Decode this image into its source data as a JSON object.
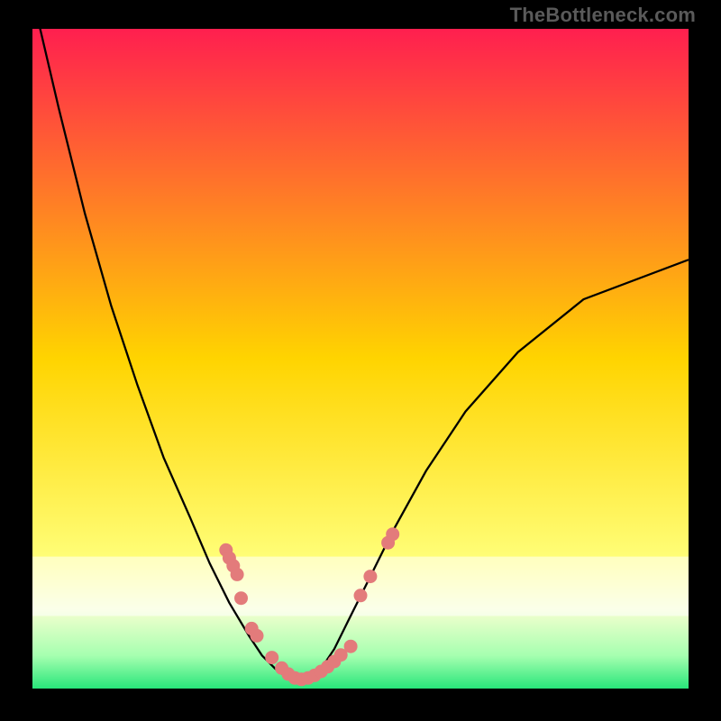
{
  "attribution": "TheBottleneck.com",
  "chart_data": {
    "type": "line",
    "title": "",
    "xlabel": "",
    "ylabel": "",
    "xlim": [
      0,
      100
    ],
    "ylim": [
      0,
      100
    ],
    "grid": false,
    "legend": false,
    "background_gradient_stops": [
      {
        "offset": 0,
        "color": "#ff1f4f"
      },
      {
        "offset": 50,
        "color": "#ffd400"
      },
      {
        "offset": 81,
        "color": "#ffff7a"
      },
      {
        "offset": 88,
        "color": "#f5ffcf"
      },
      {
        "offset": 95,
        "color": "#a6ffb0"
      },
      {
        "offset": 100,
        "color": "#28e67a"
      }
    ],
    "bottom_white_band": {
      "from_pct": 80,
      "to_pct": 89
    },
    "series": [
      {
        "name": "curve",
        "type": "line",
        "color": "#000000",
        "x": [
          0,
          4,
          8,
          12,
          16,
          20,
          24,
          27,
          30,
          33,
          35,
          37,
          39,
          40.5,
          42,
          44,
          46,
          48,
          51,
          55,
          60,
          66,
          74,
          84,
          100
        ],
        "y": [
          105,
          88,
          72,
          58,
          46,
          35,
          26,
          19,
          13,
          8,
          5,
          3,
          1.5,
          1,
          1.5,
          3,
          6,
          10,
          16,
          24,
          33,
          42,
          51,
          59,
          65
        ]
      },
      {
        "name": "dots-left",
        "type": "scatter",
        "color": "#e37b7b",
        "x": [
          29.5,
          30.0,
          30.6,
          31.2,
          31.8,
          33.4,
          34.2
        ],
        "y": [
          21.0,
          19.8,
          18.6,
          17.3,
          13.7,
          9.1,
          8.0
        ]
      },
      {
        "name": "dots-bottom",
        "type": "scatter",
        "color": "#e37b7b",
        "x": [
          36.5,
          38.0,
          39.0,
          40.0,
          41.0,
          42.0,
          43.0,
          44.0,
          45.0,
          46.0,
          47.0,
          48.5
        ],
        "y": [
          4.7,
          3.1,
          2.2,
          1.6,
          1.4,
          1.6,
          2.0,
          2.6,
          3.3,
          4.1,
          5.1,
          6.4
        ]
      },
      {
        "name": "dots-right",
        "type": "scatter",
        "color": "#e37b7b",
        "x": [
          50.0,
          51.5,
          54.2,
          54.9
        ],
        "y": [
          14.1,
          17.0,
          22.1,
          23.4
        ]
      }
    ]
  }
}
